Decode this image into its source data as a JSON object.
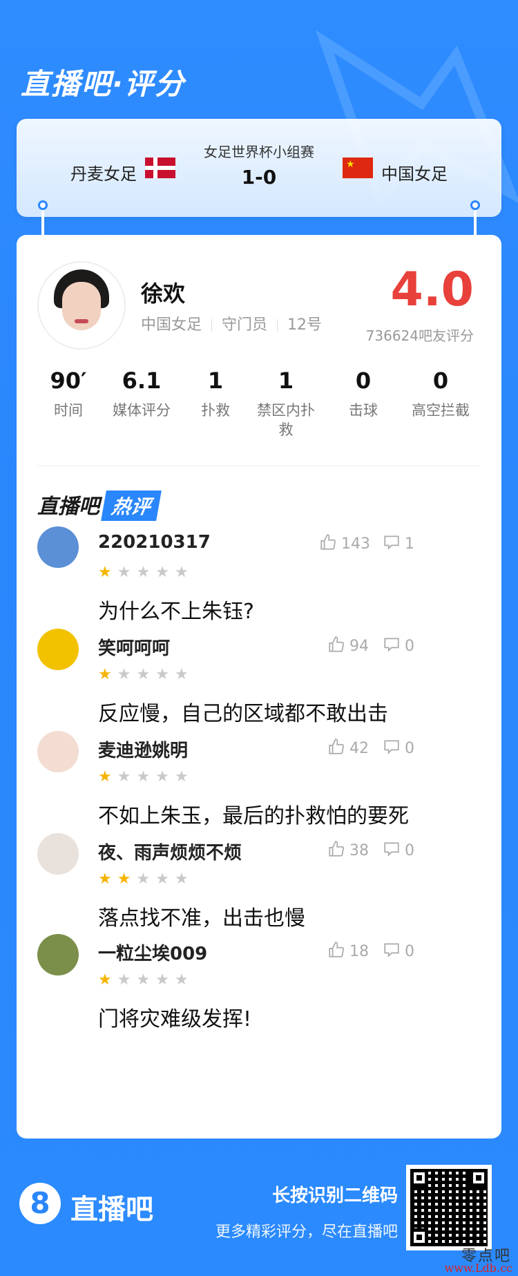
{
  "header": {
    "title": "直播吧·评分"
  },
  "match": {
    "competition": "女足世界杯小组赛",
    "score": "1-0",
    "home_team": "丹麦女足",
    "away_team": "中国女足"
  },
  "player": {
    "name": "徐欢",
    "team": "中国女足",
    "position": "守门员",
    "number": "12号",
    "rating": "4.0",
    "votes": "736624吧友评分"
  },
  "stats": [
    {
      "value": "90′",
      "label": "时间"
    },
    {
      "value": "6.1",
      "label": "媒体评分"
    },
    {
      "value": "1",
      "label": "扑救"
    },
    {
      "value": "1",
      "label": "禁区内扑救"
    },
    {
      "value": "0",
      "label": "击球"
    },
    {
      "value": "0",
      "label": "高空拦截"
    }
  ],
  "hot_section": {
    "title_part1": "直播吧",
    "title_part2": "热评"
  },
  "comments": [
    {
      "user": "220210317",
      "stars": 1,
      "text": "为什么不上朱钰?",
      "likes": "143",
      "replies": "1",
      "avatar_color": "#5b8fd6"
    },
    {
      "user": "笑呵呵呵",
      "stars": 1,
      "text": "反应慢，自己的区域都不敢出击",
      "likes": "94",
      "replies": "0",
      "avatar_color": "#f2c200"
    },
    {
      "user": "麦迪逊姚明",
      "stars": 1,
      "text": "不如上朱玉，最后的扑救怕的要死",
      "likes": "42",
      "replies": "0",
      "avatar_color": "#f3ddd2"
    },
    {
      "user": "夜、雨声烦烦不烦",
      "stars": 2,
      "text": "落点找不准，出击也慢",
      "likes": "38",
      "replies": "0",
      "avatar_color": "#e9e2dc"
    },
    {
      "user": "一粒尘埃009",
      "stars": 1,
      "text": "门将灾难级发挥!",
      "likes": "18",
      "replies": "0",
      "avatar_color": "#7c8f4a"
    }
  ],
  "footer": {
    "logo_mark": "8",
    "logo_text": "直播吧",
    "cta_line1": "长按识别二维码",
    "cta_line2": "更多精彩评分，尽在直播吧"
  },
  "watermark": {
    "line1": "零点吧",
    "line2": "www.Ldb.cc"
  },
  "colors": {
    "brand_blue": "#2a86fb",
    "rating_red": "#e8403a",
    "star_gold": "#f5b400"
  }
}
